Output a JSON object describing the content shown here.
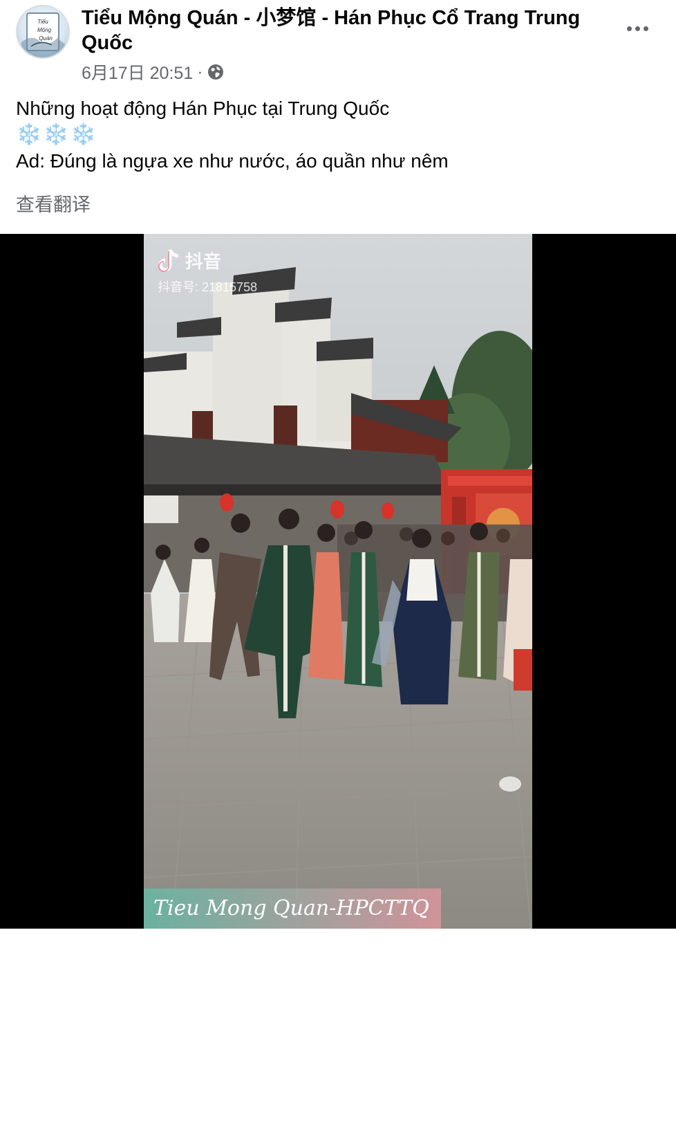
{
  "post": {
    "page_name": "Tiểu Mộng Quán - 小梦馆 - Hán Phục Cổ Trang Trung Quốc",
    "timestamp": "6月17日 20:51",
    "separator": "·",
    "audience_icon": "globe-icon",
    "menu_icon": "more-horizontal-icon",
    "avatar_text": [
      "Tiểu",
      "Mộng",
      "Quán"
    ],
    "lines": [
      "Những hoạt động Hán Phục tại Trung Quốc",
      "❄️❄️❄️",
      "Ad: Đúng là ngựa xe như nước, áo quần như nêm"
    ],
    "translate_label": "查看翻译"
  },
  "video": {
    "watermark_brand": "抖音",
    "watermark_id": "抖音号: 21815758",
    "caption": "Tieu Mong Quan-HPCTTQ",
    "mute_icon": "speaker-muted-icon"
  },
  "colors": {
    "text_primary": "#050505",
    "text_secondary": "#65676b",
    "snowflake": "#8ecff5",
    "video_bg": "#000000"
  }
}
